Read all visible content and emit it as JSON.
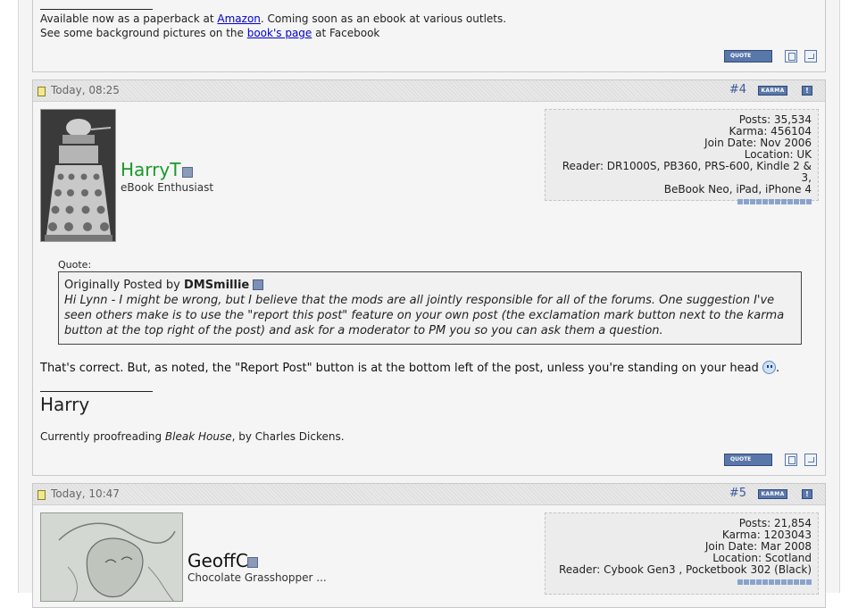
{
  "colors": {
    "accent": "#5a77aa",
    "username_green": "#1a9a2a",
    "username_black": "#111111"
  },
  "top_post": {
    "sig_line1_prefix": "Available now as a paperback at ",
    "sig_line1_link": "Amazon",
    "sig_line1_suffix": ". Coming soon as an ebook at various outlets.",
    "sig_line2_prefix": "See some background pictures on the ",
    "sig_line2_link": "book's page",
    "sig_line2_suffix": " at Facebook",
    "quote_btn": "QUOTE"
  },
  "post4": {
    "date": "Today, 08:25",
    "number": "#4",
    "karma_label": "KARMA",
    "report_label": "!",
    "username": "HarryT",
    "user_title": "eBook Enthusiast",
    "avatar_icon": "dalek-avatar",
    "info": {
      "posts": "Posts: 35,534",
      "karma": "Karma: 456104",
      "join": "Join Date: Nov 2006",
      "location": "Location: UK",
      "reader_l1": "Reader: DR1000S, PB360, PRS-600, Kindle 2 & 3,",
      "reader_l2": "BeBook Neo, iPad, iPhone 4"
    },
    "quote_label": "Quote:",
    "quote_intro": "Originally Posted by ",
    "quote_author": "DMSmillie",
    "quote_text": "Hi Lynn - I might be wrong, but I believe that the mods are all jointly responsible for all of the forums. One suggestion I've seen others make is to use the \"report this post\" feature on your own post (the exclamation mark button next to the karma button at the top right of the post) and ask for a moderator to PM you so you can ask them a question.",
    "message": "That's correct. But, as noted, the \"Report Post\" button is at the bottom left of the post, unless you're standing on your head",
    "message_end": ".",
    "sig_name": "Harry",
    "sig_text_prefix": "Currently proofreading ",
    "sig_text_book": "Bleak House",
    "sig_text_suffix": ", by Charles Dickens.",
    "quote_btn": "QUOTE"
  },
  "post5": {
    "date": "Today, 10:47",
    "number": "#5",
    "karma_label": "KARMA",
    "report_label": "!",
    "username": "GeoffC",
    "user_title": "Chocolate Grasshopper ...",
    "avatar_icon": "sketch-avatar",
    "info": {
      "posts": "Posts: 21,854",
      "karma": "Karma: 1203043",
      "join": "Join Date: Mar 2008",
      "location": "Location: Scotland",
      "reader": "Reader: Cybook Gen3 , Pocketbook 302 (Black)"
    }
  }
}
